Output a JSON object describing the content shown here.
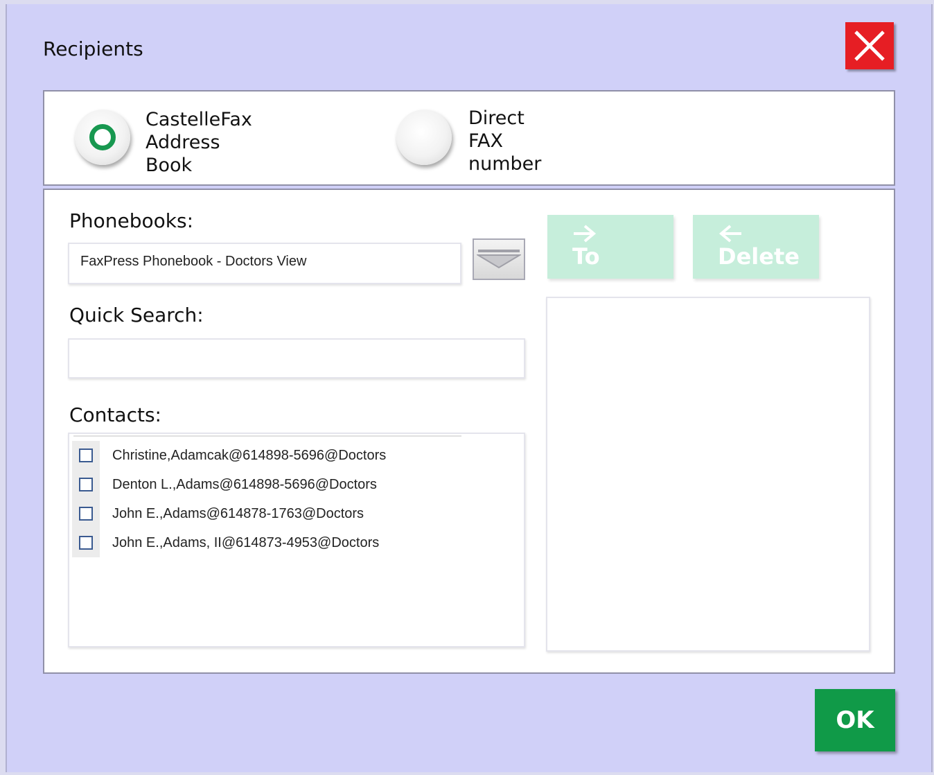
{
  "dialog": {
    "title": "Recipients",
    "close_icon": "close-x-icon"
  },
  "source_options": [
    {
      "label": "CastelleFax\nAddress\nBook",
      "selected": true
    },
    {
      "label": "Direct\nFAX\nnumber",
      "selected": false
    }
  ],
  "phonebooks": {
    "label": "Phonebooks:",
    "selected": "FaxPress Phonebook - Doctors View",
    "dropdown_icon": "chevron-down-icon"
  },
  "quick_search": {
    "label": "Quick Search:",
    "value": ""
  },
  "contacts": {
    "label": "Contacts:",
    "items": [
      {
        "text": "Christine,Adamcak@614898-5696@Doctors",
        "checked": false
      },
      {
        "text": "Denton L.,Adams@614898-5696@Doctors",
        "checked": false
      },
      {
        "text": "John E.,Adams@614878-1763@Doctors",
        "checked": false
      },
      {
        "text": "John E.,Adams, II@614873-4953@Doctors",
        "checked": false
      }
    ]
  },
  "actions": {
    "to_label": "To",
    "to_icon": "arrow-right-icon",
    "delete_label": "Delete",
    "delete_icon": "arrow-left-icon"
  },
  "recipients": [],
  "ok_label": "OK",
  "colors": {
    "background": "#d0d0f8",
    "close_red": "#e61e24",
    "ok_green": "#109a48",
    "disabled_green": "#c6eedb",
    "radio_green": "#189850"
  }
}
